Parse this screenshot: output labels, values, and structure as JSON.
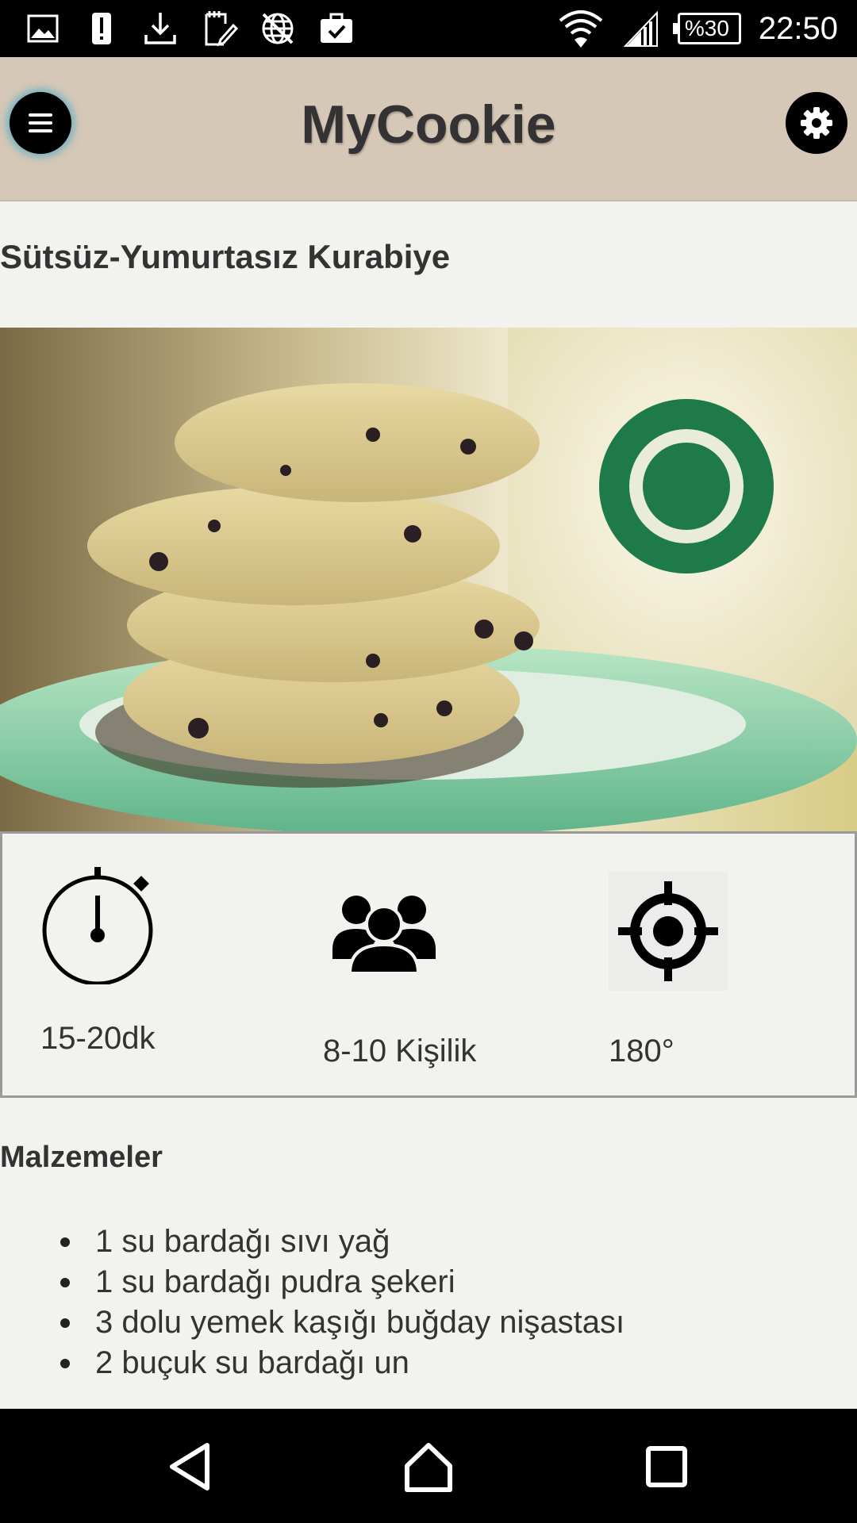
{
  "status_bar": {
    "battery": "%30",
    "time": "22:50",
    "icons": [
      "gallery-icon",
      "alert-icon",
      "download-icon",
      "note-edit-icon",
      "globe-icon",
      "briefcase-check-icon",
      "wifi-icon",
      "signal-icon",
      "battery-icon"
    ]
  },
  "app_bar": {
    "title": "MyCookie",
    "menu_icon": "hamburger-menu-icon",
    "settings_icon": "gear-icon"
  },
  "recipe": {
    "title": "Sütsüz-Yumurtasız Kurabiye",
    "image": "cookies-stack-photo",
    "info": {
      "time": {
        "icon": "stopwatch-icon",
        "label": "15-20dk"
      },
      "servings": {
        "icon": "people-group-icon",
        "label": "8-10 Kişilik"
      },
      "temperature": {
        "icon": "target-crosshair-icon",
        "label": "180°"
      }
    },
    "ingredients_title": "Malzemeler",
    "ingredients": [
      "1 su bardağı sıvı yağ",
      "1 su bardağı pudra şekeri",
      "3 dolu yemek kaşığı buğday nişastası",
      "2 buçuk su bardağı un"
    ]
  },
  "nav_bar": {
    "icons": [
      "back-icon",
      "home-icon",
      "recents-icon"
    ]
  },
  "colors": {
    "app_bar": "#d6c8b6",
    "background": "#f2f2ee",
    "text": "#333333",
    "glow": "#50aac8"
  }
}
